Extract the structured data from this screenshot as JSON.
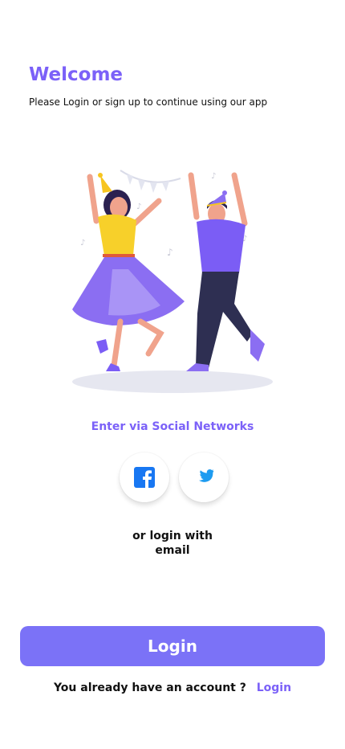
{
  "header": {
    "title": "Welcome",
    "subtitle": "Please Login or sign up to continue using our app"
  },
  "illustration": {
    "icon": "dancing-couple-illustration"
  },
  "social": {
    "heading": "Enter via Social Networks",
    "buttons": [
      {
        "name": "facebook",
        "icon": "facebook-icon",
        "color": "#1877f2"
      },
      {
        "name": "twitter",
        "icon": "twitter-icon",
        "color": "#1d9bf0"
      }
    ]
  },
  "email": {
    "line1": "or login with",
    "line2": "email"
  },
  "login_button": {
    "label": "Login"
  },
  "footer": {
    "question": "You already have an account ?",
    "link": "Login"
  },
  "colors": {
    "accent": "#7b61f8",
    "button": "#7b72f7"
  }
}
